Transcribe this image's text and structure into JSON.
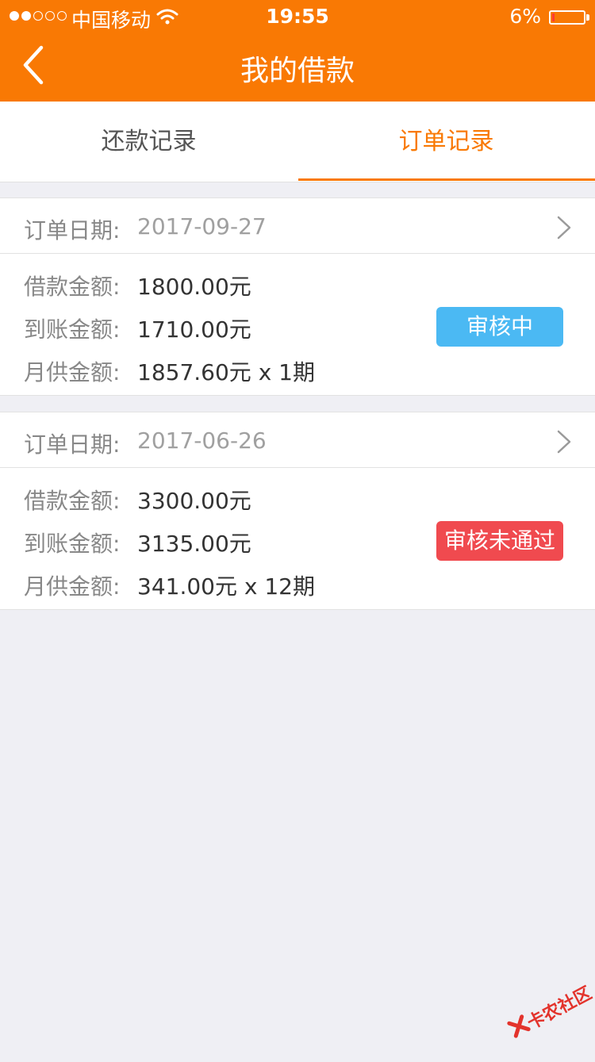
{
  "status_bar": {
    "carrier": "中国移动",
    "time": "19:55",
    "battery": "6%",
    "battery_level": 0.06,
    "signal_bars_filled": 2,
    "signal_bars_total": 5
  },
  "nav": {
    "title": "我的借款",
    "back_icon": "chevron-left-icon"
  },
  "tabs": [
    {
      "label": "还款记录",
      "active": false
    },
    {
      "label": "订单记录",
      "active": true
    }
  ],
  "colors": {
    "brand": "#f97904",
    "pending": "#4bb9f3",
    "rejected": "#f04a4f"
  },
  "orders": [
    {
      "date_label": "订单日期:",
      "date": "2017-09-27",
      "loan_label": "借款金额:",
      "loan_amount": "1800.00元",
      "received_label": "到账金额:",
      "received_amount": "1710.00元",
      "monthly_label": "月供金额:",
      "monthly_amount": "1857.60元 x 1期",
      "status": "审核中",
      "status_color": "#4bb9f3"
    },
    {
      "date_label": "订单日期:",
      "date": "2017-06-26",
      "loan_label": "借款金额:",
      "loan_amount": "3300.00元",
      "received_label": "到账金额:",
      "received_amount": "3135.00元",
      "monthly_label": "月供金额:",
      "monthly_amount": "341.00元 x 12期",
      "status": "审核未通过",
      "status_color": "#f04a4f"
    }
  ],
  "watermark": "卡农社区"
}
